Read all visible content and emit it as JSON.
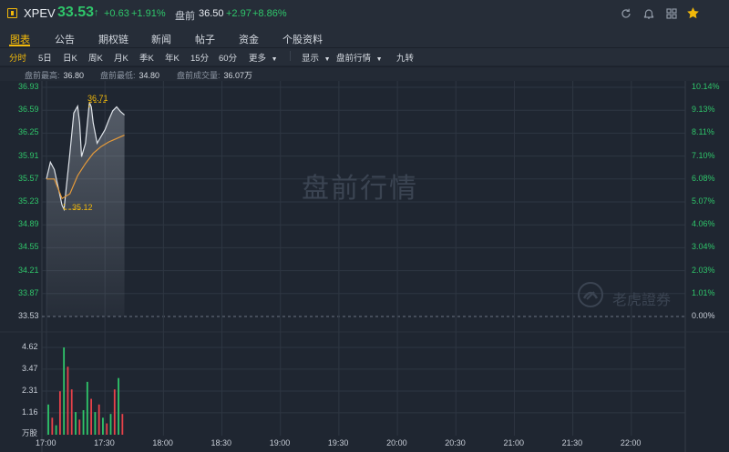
{
  "header": {
    "symbol": "XPEV",
    "price": "33.53",
    "price_arrow": "↑",
    "change": "+0.63",
    "change_pct": "+1.91%",
    "premarket_label": "盘前",
    "premarket_price": "36.50",
    "premarket_change": "+2.97",
    "premarket_change_pct": "+8.86%",
    "icons": [
      "refresh-icon",
      "bell-icon",
      "grid-icon",
      "star-icon"
    ]
  },
  "tabs": [
    "图表",
    "公告",
    "期权链",
    "新闻",
    "帖子",
    "资金",
    "个股资料"
  ],
  "toolbar": {
    "periods": [
      "分时",
      "5日",
      "日K",
      "周K",
      "月K",
      "季K",
      "年K",
      "15分",
      "60分"
    ],
    "more": "更多",
    "display": "显示",
    "premarket_quote": "盘前行情",
    "nine_turn": "九转"
  },
  "stats": {
    "high_label": "盘前最高:",
    "high": "36.80",
    "low_label": "盘前最低:",
    "low": "34.80",
    "volume_label": "盘前成交量:",
    "volume": "36.07万"
  },
  "watermark": "盘前行情",
  "brand_watermark": "老虎證券",
  "chart_data": {
    "type": "line",
    "title": "",
    "price_axis": [
      "36.93",
      "36.59",
      "36.25",
      "35.91",
      "35.57",
      "35.23",
      "34.89",
      "34.55",
      "34.21",
      "33.87",
      "33.53"
    ],
    "pct_axis": [
      "10.14%",
      "9.13%",
      "8.11%",
      "7.10%",
      "6.08%",
      "5.07%",
      "4.06%",
      "3.04%",
      "2.03%",
      "1.01%",
      "0.00%"
    ],
    "ylim": [
      33.53,
      36.93
    ],
    "x_ticks": [
      "17:00",
      "17:30",
      "18:00",
      "18:30",
      "19:00",
      "19:30",
      "20:00",
      "20:30",
      "21:00",
      "21:30",
      "22:00"
    ],
    "callouts": {
      "high": "36.71",
      "low": "35.12"
    },
    "series": [
      {
        "kind": "price",
        "x": [
          0,
          2,
          4,
          6,
          8,
          9,
          10,
          12,
          14,
          16,
          17,
          18,
          20,
          22,
          23,
          24,
          26,
          28,
          30,
          32,
          34,
          36,
          38,
          40
        ],
        "values": [
          35.57,
          35.82,
          35.71,
          35.45,
          35.18,
          35.12,
          35.4,
          35.95,
          36.55,
          36.65,
          36.4,
          35.9,
          36.1,
          36.71,
          36.64,
          36.4,
          36.1,
          36.2,
          36.3,
          36.45,
          36.58,
          36.64,
          36.57,
          36.52
        ]
      },
      {
        "kind": "average",
        "x": [
          0,
          4,
          8,
          12,
          16,
          20,
          24,
          28,
          32,
          36,
          40
        ],
        "values": [
          35.57,
          35.57,
          35.28,
          35.35,
          35.62,
          35.8,
          35.95,
          36.05,
          36.12,
          36.17,
          36.22
        ]
      }
    ],
    "volume": {
      "axis": [
        "4.62",
        "3.47",
        "2.31",
        "1.16"
      ],
      "unit": "万股",
      "ylim": [
        0,
        5.2
      ],
      "x": [
        1,
        3,
        5,
        7,
        9,
        11,
        13,
        15,
        17,
        19,
        21,
        23,
        25,
        27,
        29,
        31,
        33,
        35,
        37,
        39
      ],
      "values": [
        1.6,
        0.9,
        0.5,
        2.3,
        4.62,
        3.6,
        2.4,
        1.2,
        0.8,
        1.3,
        2.8,
        1.9,
        1.2,
        1.6,
        0.9,
        0.6,
        1.1,
        2.4,
        3.0,
        1.1
      ],
      "colors": [
        "#2fc56a",
        "#e8424a",
        "#2fc56a",
        "#e8424a",
        "#2fc56a",
        "#e8424a",
        "#e8424a",
        "#2fc56a",
        "#e8424a",
        "#2fc56a",
        "#2fc56a",
        "#e8424a",
        "#2fc56a",
        "#e8424a",
        "#2fc56a",
        "#e8424a",
        "#2fc56a",
        "#e8424a",
        "#2fc56a",
        "#e8424a"
      ]
    }
  }
}
